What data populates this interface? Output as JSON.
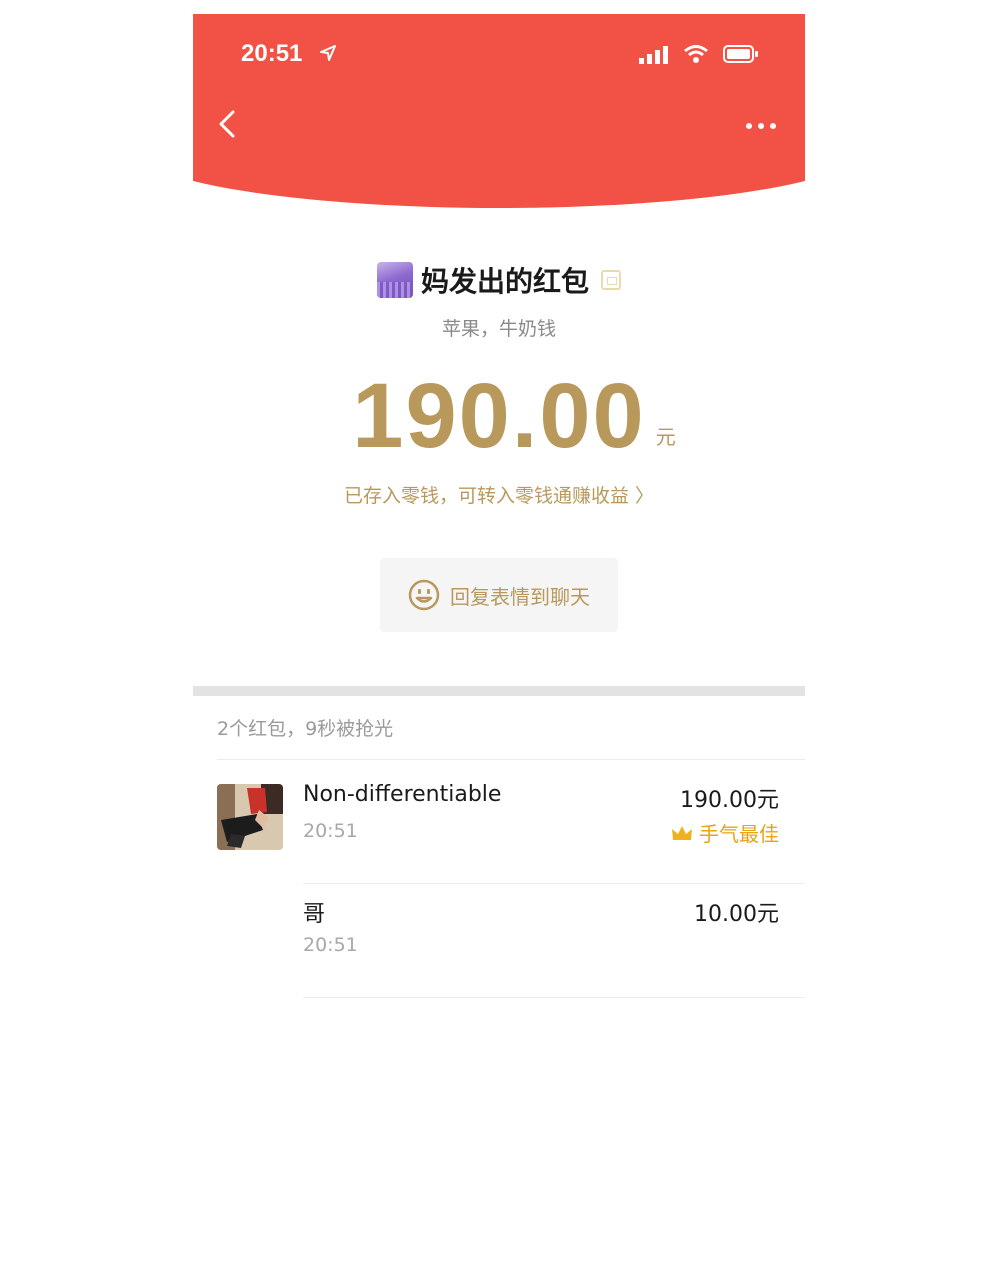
{
  "status_bar": {
    "time": "20:51"
  },
  "sender": {
    "title": "妈发出的红包",
    "message": "苹果，牛奶钱"
  },
  "amount": {
    "value": "190.00",
    "unit": "元"
  },
  "deposit_link": "已存入零钱，可转入零钱通赚收益 〉",
  "reply_button_label": "回复表情到聊天",
  "summary": "2个红包，9秒被抢光",
  "recipients": [
    {
      "name": "Non-differentiable",
      "time": "20:51",
      "amount": "190.00元",
      "badge": "手气最佳"
    },
    {
      "name": "哥",
      "time": "20:51",
      "amount": "10.00元"
    }
  ],
  "colors": {
    "header": "#f15245",
    "gold": "#b8995b",
    "best_luck": "#e8a317"
  }
}
